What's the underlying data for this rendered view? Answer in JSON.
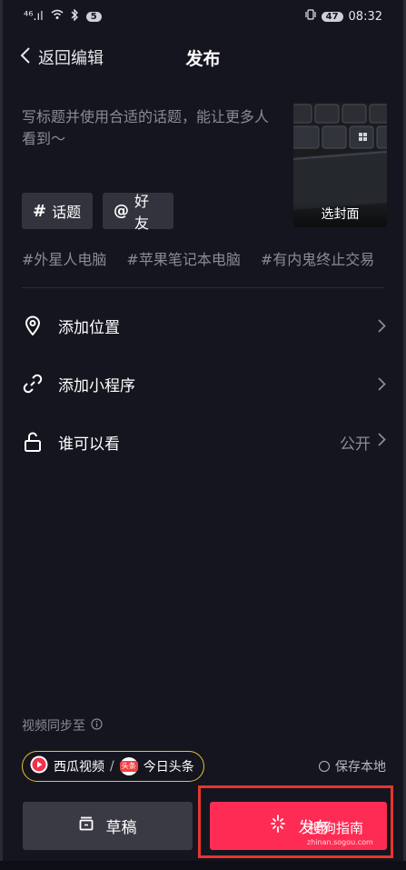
{
  "status": {
    "network": "⁴⁶.ıl",
    "badge": "5",
    "battery": "47",
    "time": "08:32"
  },
  "header": {
    "back_label": "返回编辑",
    "title": "发布"
  },
  "caption": {
    "placeholder": "写标题并使用合适的话题，能让更多人看到～"
  },
  "cover": {
    "label": "选封面"
  },
  "chips": {
    "topic": "话题",
    "friend": "好友"
  },
  "suggested_tags": [
    "#外星人电脑",
    "#苹果笔记本电脑",
    "#有内鬼终止交易"
  ],
  "options": {
    "location": "添加位置",
    "mini_program": "添加小程序",
    "visibility": "谁可以看",
    "visibility_value": "公开"
  },
  "sync": {
    "label": "视频同步至",
    "xigua": "西瓜视频",
    "separator": "/",
    "toutiao_badge": "头条",
    "toutiao": "今日头条",
    "save_local": "保存本地"
  },
  "actions": {
    "draft": "草稿",
    "publish": "发布"
  },
  "watermark": {
    "text": "搜狗指南",
    "sub": "zhinan.sogou.com"
  },
  "colors": {
    "background": "#15151f",
    "accent": "#fe2c55",
    "platform_border": "#e8c230",
    "highlight": "#e8352e"
  }
}
